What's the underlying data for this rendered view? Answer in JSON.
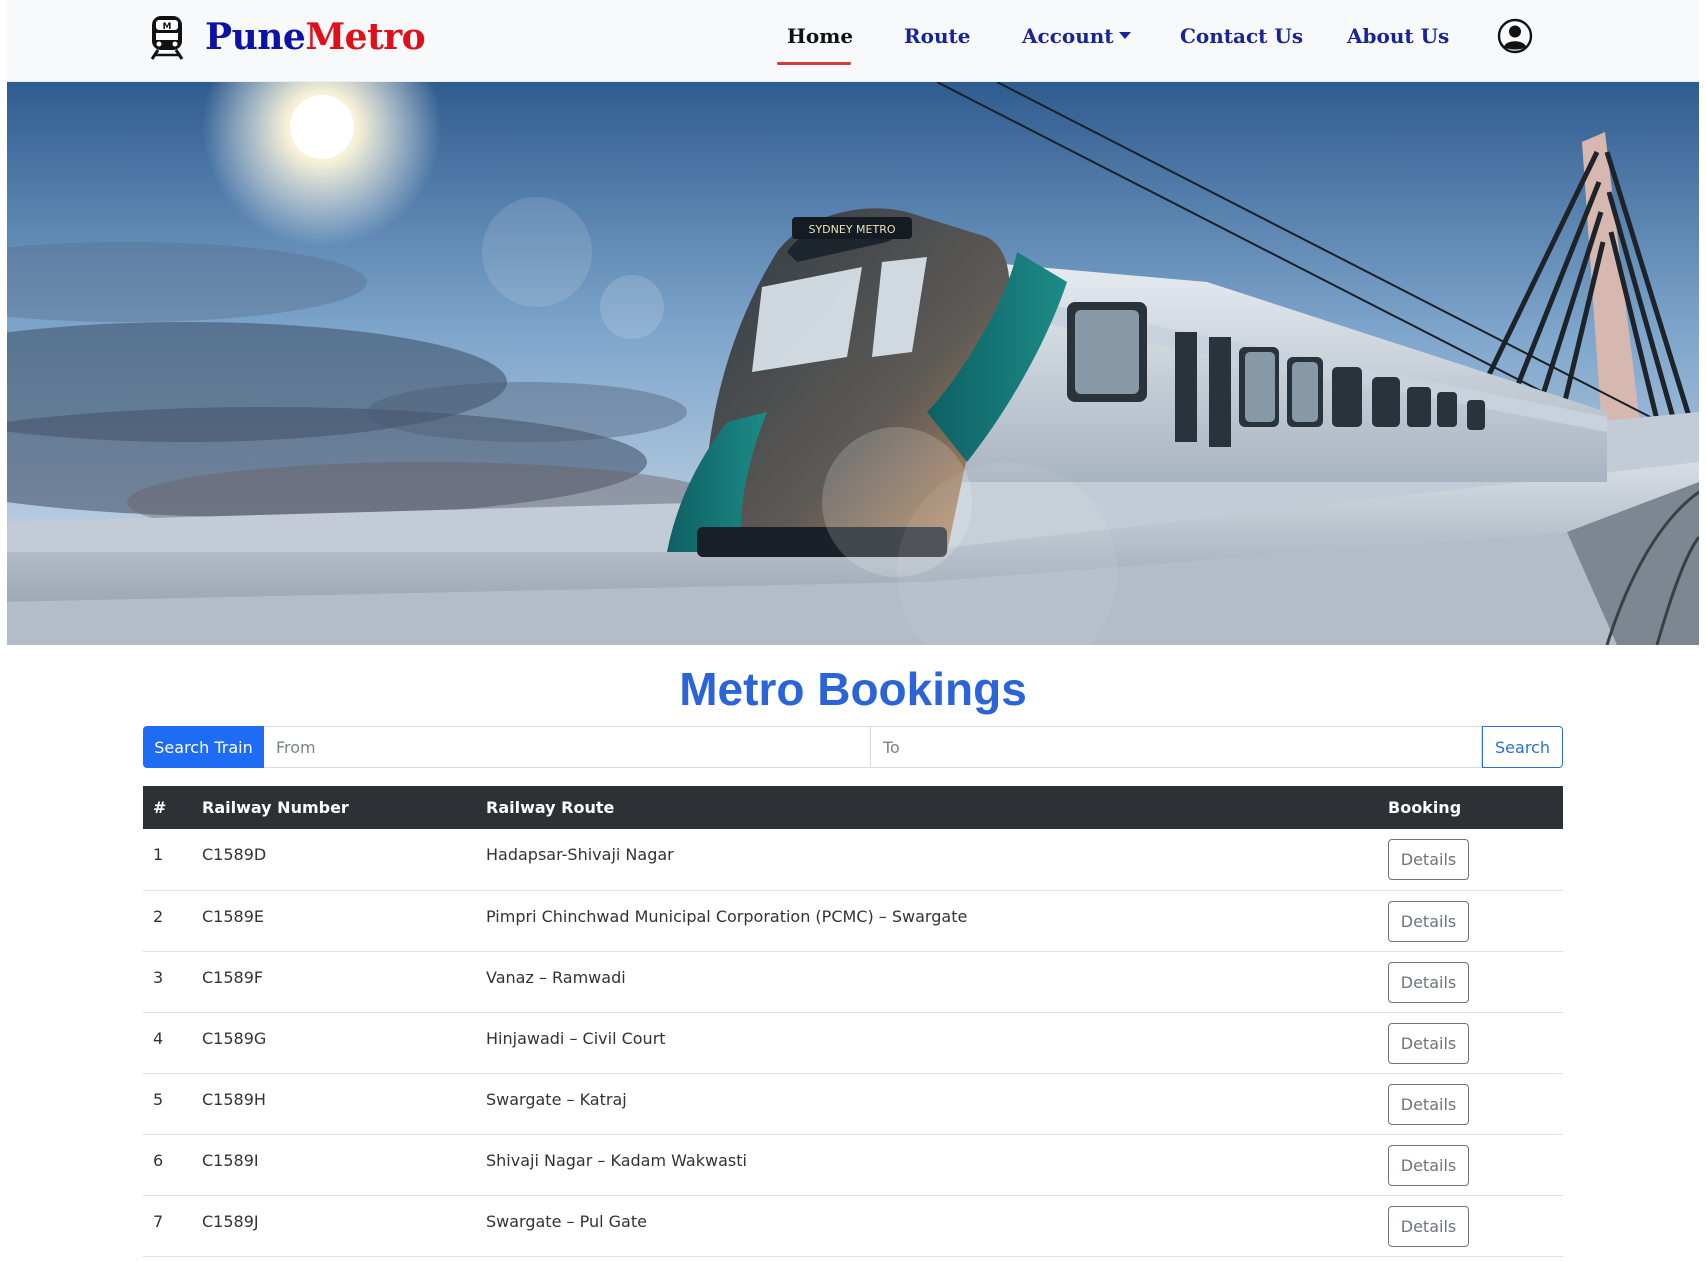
{
  "brand": {
    "pune": "Pune",
    "metro": "Metro"
  },
  "nav": {
    "home": "Home",
    "route": "Route",
    "account": "Account",
    "contact": "Contact Us",
    "about": "About Us"
  },
  "hero": {
    "train_destination_sign": "SYDNEY METRO"
  },
  "page_title": "Metro Bookings",
  "search": {
    "label": "Search Train",
    "from_placeholder": "From",
    "to_placeholder": "To",
    "button": "Search"
  },
  "table": {
    "headers": {
      "index": "#",
      "number": "Railway Number",
      "route": "Railway Route",
      "booking": "Booking"
    },
    "rows": [
      {
        "index": "1",
        "number": "C1589D",
        "route": "Hadapsar-Shivaji Nagar",
        "action": "Details"
      },
      {
        "index": "2",
        "number": "C1589E",
        "route": "Pimpri Chinchwad Municipal Corporation (PCMC) – Swargate",
        "action": "Details"
      },
      {
        "index": "3",
        "number": "C1589F",
        "route": "Vanaz – Ramwadi",
        "action": "Details"
      },
      {
        "index": "4",
        "number": "C1589G",
        "route": "Hinjawadi – Civil Court",
        "action": "Details"
      },
      {
        "index": "5",
        "number": "C1589H",
        "route": "Swargate – Katraj",
        "action": "Details"
      },
      {
        "index": "6",
        "number": "C1589I",
        "route": "Shivaji Nagar – Kadam Wakwasti",
        "action": "Details"
      },
      {
        "index": "7",
        "number": "C1589J",
        "route": "Swargate – Pul Gate",
        "action": "Details"
      }
    ]
  },
  "colors": {
    "brand_pune": "#0b12a4",
    "brand_metro": "#e0101a",
    "nav_link": "#1a2496",
    "active_underline": "#d63a3a",
    "title": "#2b63d9",
    "primary": "#1e6cf4",
    "table_header": "#2d3034"
  },
  "icons": {
    "logo": "metro-train-icon",
    "profile": "user-circle-icon"
  }
}
